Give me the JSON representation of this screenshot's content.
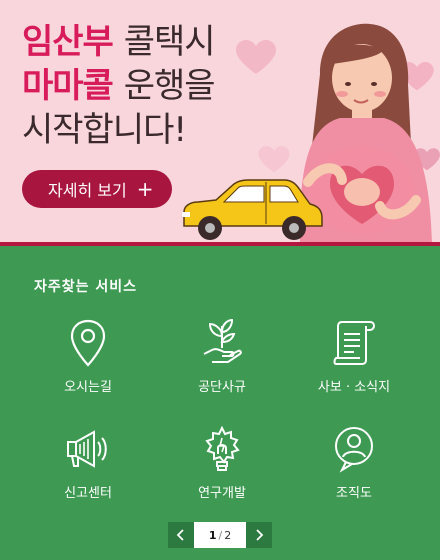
{
  "banner": {
    "line1_accent": "임산부",
    "line1_rest": "콜택시",
    "line2_accent": "마마콜",
    "line2_rest": "운행을",
    "line3": "시작합니다!",
    "more_label": "자세히 보기",
    "more_icon": "+",
    "colors": {
      "background": "#f9d6dc",
      "accent": "#d81b5a",
      "button": "#a81640",
      "taxi": "#f5c518"
    }
  },
  "services": {
    "title": "자주찾는 서비스",
    "items": [
      {
        "label": "오시는길",
        "icon": "location-pin-icon"
      },
      {
        "label": "공단사규",
        "icon": "plant-hand-icon"
      },
      {
        "label": "사보 · 소식지",
        "icon": "scroll-icon"
      },
      {
        "label": "신고센터",
        "icon": "megaphone-icon"
      },
      {
        "label": "연구개발",
        "icon": "gear-bulb-icon"
      },
      {
        "label": "조직도",
        "icon": "person-chat-icon"
      }
    ],
    "pager": {
      "current": "1",
      "separator": "/",
      "total": "2"
    },
    "colors": {
      "background": "#3e9a53",
      "pager_arrow": "#2d7a41"
    }
  }
}
